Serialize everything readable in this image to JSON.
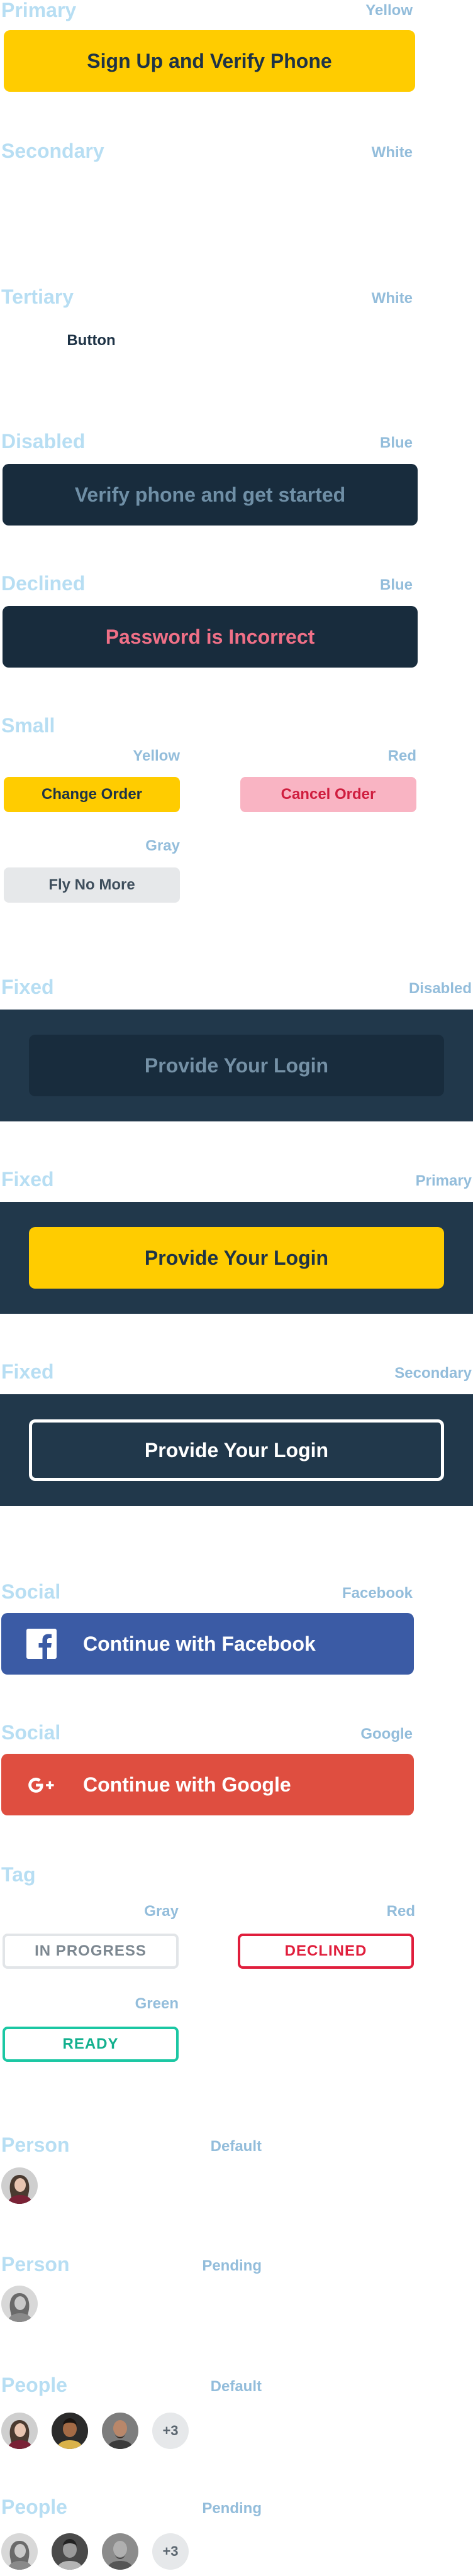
{
  "sections": {
    "primary": {
      "title": "Primary",
      "variant": "Yellow",
      "button": "Sign Up and Verify Phone"
    },
    "secondary": {
      "title": "Secondary",
      "variant": "White"
    },
    "tertiary": {
      "title": "Tertiary",
      "variant": "White",
      "button": "Button"
    },
    "disabled": {
      "title": "Disabled",
      "variant": "Blue",
      "button": "Verify phone and get started"
    },
    "declined": {
      "title": "Declined",
      "variant": "Blue",
      "button": "Password is Incorrect"
    },
    "small": {
      "title": "Small",
      "yellow": {
        "variant": "Yellow",
        "button": "Change Order"
      },
      "red": {
        "variant": "Red",
        "button": "Cancel Order"
      },
      "gray": {
        "variant": "Gray",
        "button": "Fly No More"
      }
    },
    "fixed_disabled": {
      "title": "Fixed",
      "variant": "Disabled",
      "button": "Provide Your Login"
    },
    "fixed_primary": {
      "title": "Fixed",
      "variant": "Primary",
      "button": "Provide Your Login"
    },
    "fixed_secondary": {
      "title": "Fixed",
      "variant": "Secondary",
      "button": "Provide Your Login"
    },
    "social_facebook": {
      "title": "Social",
      "variant": "Facebook",
      "button": "Continue with Facebook",
      "icon": "facebook-icon"
    },
    "social_google": {
      "title": "Social",
      "variant": "Google",
      "button": "Continue with Google",
      "icon": "google-plus-icon"
    },
    "tag": {
      "title": "Tag",
      "gray": {
        "variant": "Gray",
        "text": "IN PROGRESS"
      },
      "red": {
        "variant": "Red",
        "text": "DECLINED"
      },
      "green": {
        "variant": "Green",
        "text": "READY"
      }
    },
    "person_default": {
      "title": "Person",
      "variant": "Default"
    },
    "person_pending": {
      "title": "Person",
      "variant": "Pending"
    },
    "people_default": {
      "title": "People",
      "variant": "Default",
      "more": "+3"
    },
    "people_pending": {
      "title": "People",
      "variant": "Pending",
      "more": "+3"
    }
  },
  "colors": {
    "heading": "#b7def3",
    "variant_label": "#93bddb",
    "primary": "#ffcc00",
    "navy": "#182c3d",
    "band": "#21384b",
    "facebook": "#3b5ba5",
    "google": "#df4e40",
    "tag_red": "#e01e3c",
    "tag_green": "#1bc7a3"
  }
}
